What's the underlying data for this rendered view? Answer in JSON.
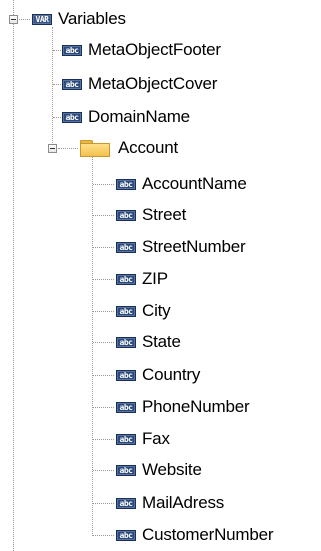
{
  "tree": {
    "root": {
      "badge": "VAR",
      "label": "Variables",
      "icon": "var-icon"
    },
    "root_children": [
      {
        "badge": "abc",
        "label": "MetaObjectFooter"
      },
      {
        "badge": "abc",
        "label": "MetaObjectCover"
      },
      {
        "badge": "abc",
        "label": "DomainName"
      }
    ],
    "folder": {
      "label": "Account",
      "icon": "folder-icon"
    },
    "folder_children": [
      {
        "badge": "abc",
        "label": "AccountName"
      },
      {
        "badge": "abc",
        "label": "Street"
      },
      {
        "badge": "abc",
        "label": "StreetNumber"
      },
      {
        "badge": "abc",
        "label": "ZIP"
      },
      {
        "badge": "abc",
        "label": "City"
      },
      {
        "badge": "abc",
        "label": "State"
      },
      {
        "badge": "abc",
        "label": "Country"
      },
      {
        "badge": "abc",
        "label": "PhoneNumber"
      },
      {
        "badge": "abc",
        "label": "Fax"
      },
      {
        "badge": "abc",
        "label": "Website"
      },
      {
        "badge": "abc",
        "label": "MailAdress"
      },
      {
        "badge": "abc",
        "label": "CustomerNumber"
      }
    ]
  },
  "colors": {
    "badge_bg": "#2c4a7a",
    "folder": "#f2c14e",
    "connector": "#9a9a9a"
  }
}
